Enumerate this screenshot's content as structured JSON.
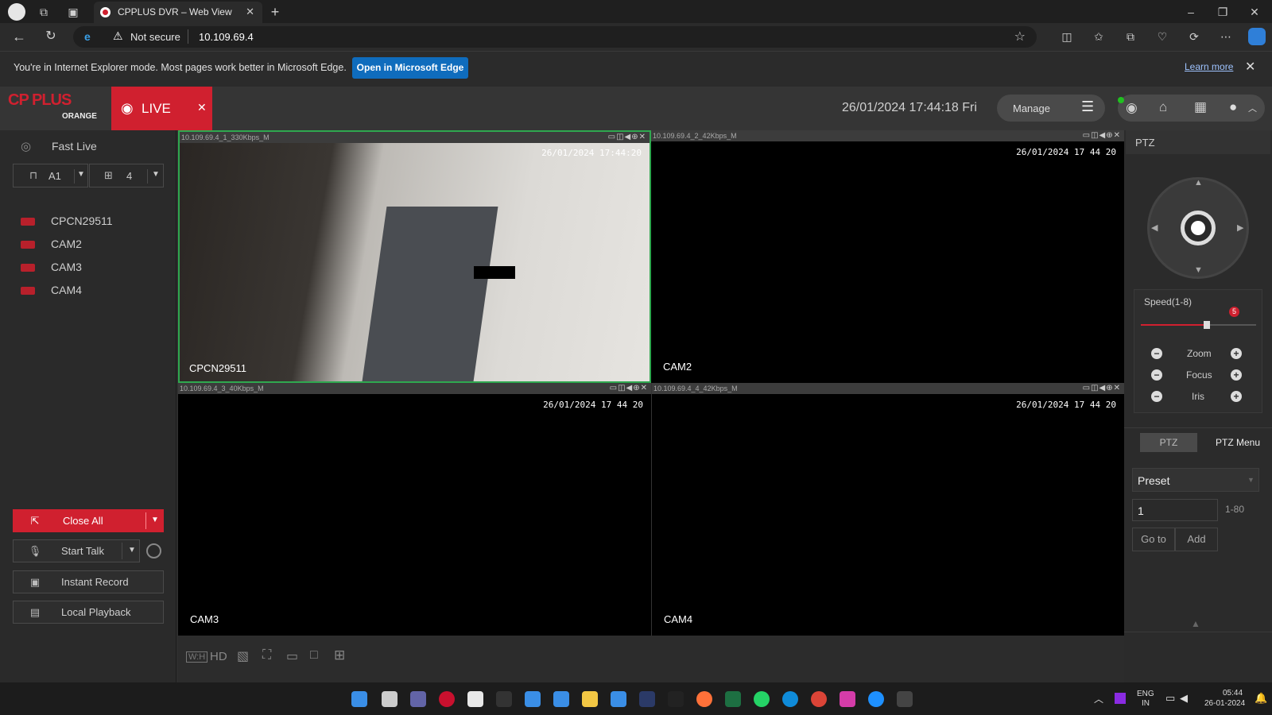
{
  "browser": {
    "tab_title": "CPPLUS DVR – Web View",
    "security_label": "Not secure",
    "url": "10.109.69.4",
    "infobar_text": "You're in Internet Explorer mode. Most pages work better in Microsoft Edge.",
    "open_edge_label": "Open in Microsoft Edge",
    "learn_more_label": "Learn more"
  },
  "app": {
    "logo_text": "CP PLUS",
    "logo_sub": "ORANGE",
    "live_tab_label": "LIVE",
    "datetime": "26/01/2024 17:44:18 Fri",
    "manage_label": "Manage"
  },
  "left_panel": {
    "fast_live_label": "Fast Live",
    "channel_select": "A1",
    "split_select": "4",
    "cameras": [
      {
        "label": "CPCN29511"
      },
      {
        "label": "CAM2"
      },
      {
        "label": "CAM3"
      },
      {
        "label": "CAM4"
      }
    ],
    "close_all_label": "Close All",
    "start_talk_label": "Start Talk",
    "instant_record_label": "Instant Record",
    "local_playback_label": "Local Playback"
  },
  "video": {
    "cells": [
      {
        "stream": "10.109.69.4_1_330Kbps_M",
        "timestamp": "26/01/2024 17:44:20",
        "name": "CPCN29511"
      },
      {
        "stream": "10.109.69.4_2_42Kbps_M",
        "timestamp": "26/01/2024 17 44 20",
        "name": "CAM2"
      },
      {
        "stream": "10.109.69.4_3_40Kbps_M",
        "timestamp": "26/01/2024 17 44 20",
        "name": "CAM3"
      },
      {
        "stream": "10.109.69.4_4_42Kbps_M",
        "timestamp": "26/01/2024 17 44 20",
        "name": "CAM4"
      }
    ],
    "hd_label": "HD"
  },
  "ptz": {
    "title": "PTZ",
    "speed_label": "Speed(1-8)",
    "speed_value": "5",
    "speed_fraction": 0.57,
    "zoom_label": "Zoom",
    "focus_label": "Focus",
    "iris_label": "Iris",
    "tab_ptz": "PTZ",
    "tab_menu": "PTZ Menu",
    "preset_select": "Preset",
    "preset_value": "1",
    "preset_range": "1-80",
    "goto_label": "Go to",
    "add_label": "Add"
  },
  "taskbar": {
    "lang": "ENG",
    "region": "IN",
    "time": "05:44",
    "date": "26-01-2024"
  },
  "colors": {
    "accent_red": "#d0202f",
    "edge_blue": "#0f6cbd",
    "panel_bg": "#2a2a2a"
  }
}
